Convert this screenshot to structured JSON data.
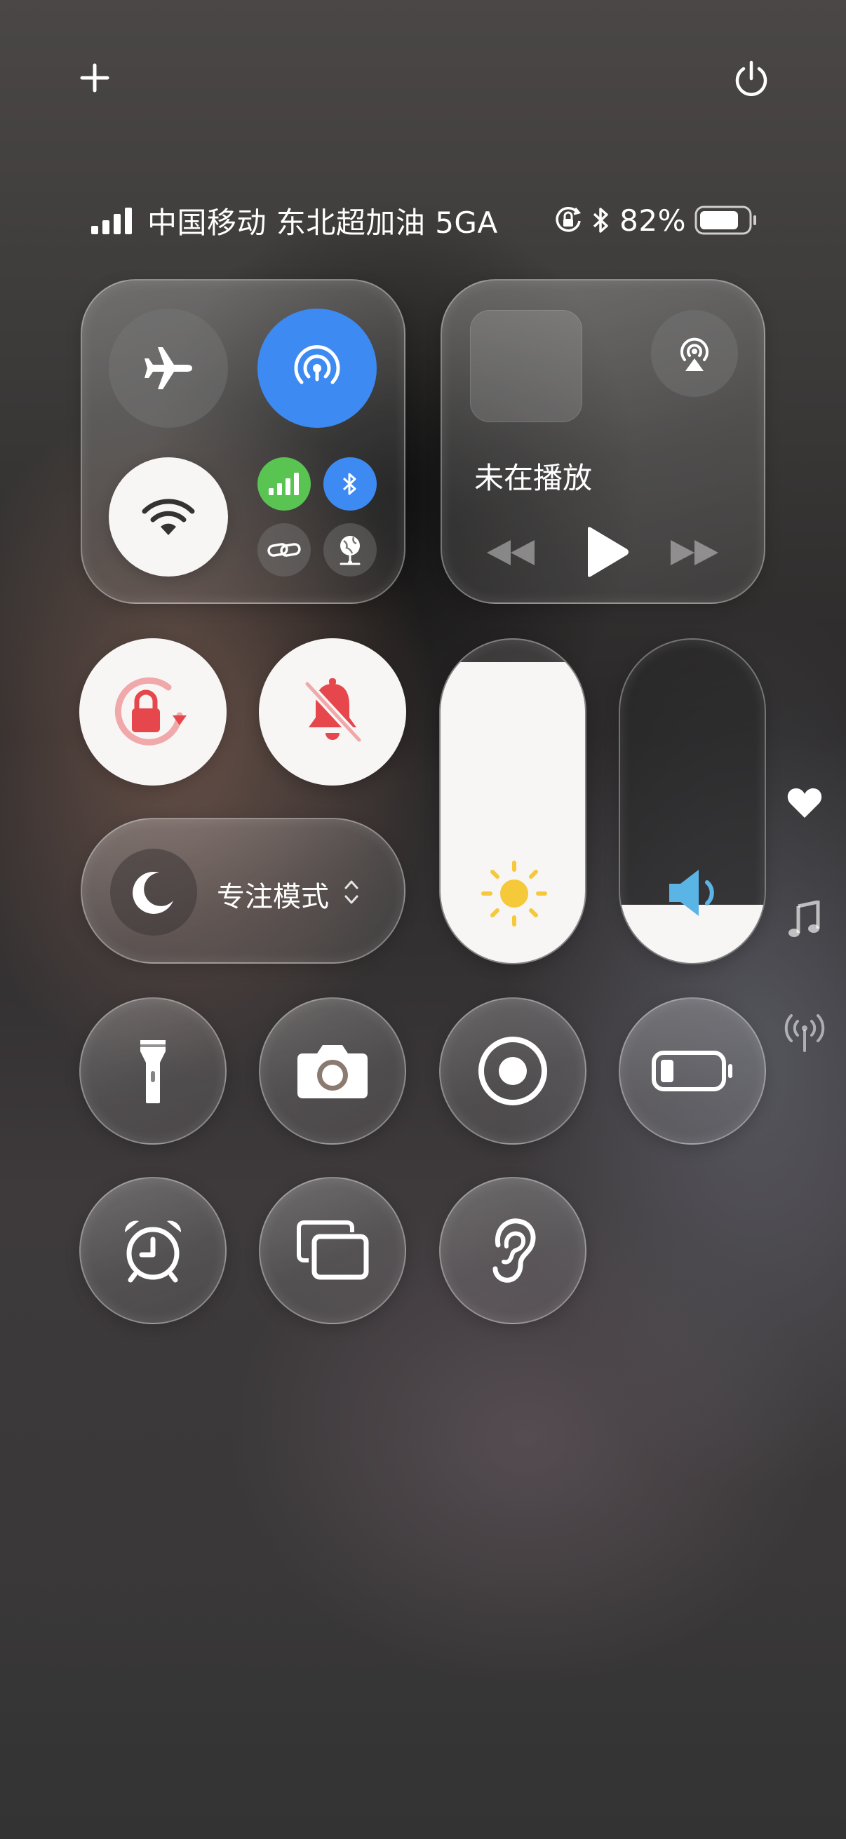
{
  "top": {
    "add_icon": "plus-icon",
    "power_icon": "power-icon"
  },
  "status_bar": {
    "carrier": "中国移动 东北超加油 5GA",
    "battery_percent": "82%",
    "battery_level": 0.82,
    "icons": [
      "signal-icon",
      "orientation-lock-icon",
      "bluetooth-icon",
      "battery-icon"
    ]
  },
  "connectivity": {
    "airplane_mode": false,
    "airdrop_hotspot": true,
    "wifi": true,
    "cellular": true,
    "bluetooth": true,
    "colors": {
      "blue": "#3d8bf2",
      "green": "#59c452"
    }
  },
  "media": {
    "title": "未在播放",
    "airplay_icon": "airplay-icon"
  },
  "toggles": {
    "orientation_lock": true,
    "silent_mode": true,
    "accent_red": "#e6474c"
  },
  "focus": {
    "label": "专注模式"
  },
  "sliders": {
    "brightness": {
      "level": 0.93,
      "icon": "sun-icon",
      "color": "#f6c93a"
    },
    "volume": {
      "level": 0.18,
      "icon": "speaker-icon",
      "color": "#5ab4e5"
    }
  },
  "shortcuts": [
    {
      "name": "flashlight-icon"
    },
    {
      "name": "camera-icon"
    },
    {
      "name": "screen-record-icon"
    },
    {
      "name": "low-power-icon"
    },
    {
      "name": "alarm-icon"
    },
    {
      "name": "screen-mirror-icon"
    },
    {
      "name": "hearing-icon"
    }
  ],
  "side_indicators": [
    "heart-icon",
    "music-note-icon",
    "antenna-icon"
  ]
}
